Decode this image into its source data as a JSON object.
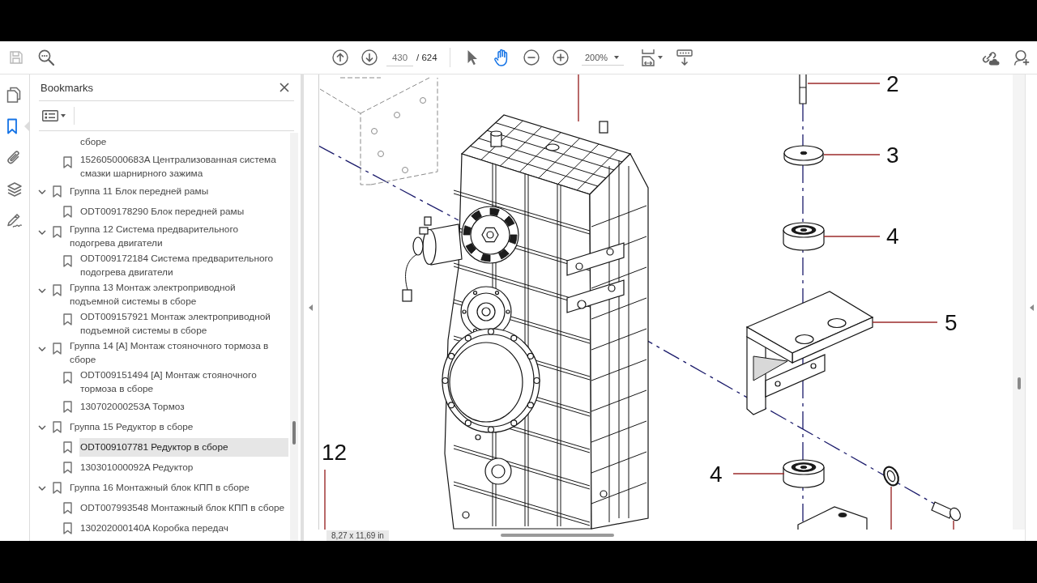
{
  "toolbar": {
    "save_button": {
      "disabled": true
    },
    "page_field": {
      "value": "430"
    },
    "page_count": "/ 624",
    "tools": [
      {
        "kind": "select",
        "selected": false
      },
      {
        "kind": "hand",
        "selected": true
      }
    ],
    "zoom_field": {
      "value": "200%"
    }
  },
  "sidebar": {
    "tabs": [
      {
        "kind": "pages",
        "selected": false
      },
      {
        "kind": "bookmarks",
        "selected": true
      },
      {
        "kind": "attachments",
        "selected": false
      },
      {
        "kind": "layers",
        "selected": false
      },
      {
        "kind": "signatures",
        "selected": false
      }
    ]
  },
  "bookmarks_panel": {
    "title": "Bookmarks",
    "items": [
      {
        "kind": "offscreen",
        "children": [
          {
            "kind": "fragment",
            "title": "сборе",
            "selected": false
          },
          {
            "kind": "bookmark",
            "title": "152605000683A Централизованная система смазки шарнирного зажима",
            "selected": false
          }
        ]
      },
      {
        "kind": "group",
        "title": "Группа 11 Блок передней рамы",
        "expanded": true,
        "selected": false,
        "children": [
          {
            "kind": "bookmark",
            "title": "ODT009178290 Блок передней рамы",
            "selected": false
          }
        ]
      },
      {
        "kind": "group",
        "title": "Группа 12 Система предварительного подогрева двигатели",
        "expanded": true,
        "selected": false,
        "children": [
          {
            "kind": "bookmark",
            "title": "ODT009172184 Система предварительного подогрева двигатели",
            "selected": false
          }
        ]
      },
      {
        "kind": "group",
        "title": "Группа 13 Монтаж электроприводной подъемной системы в сборе",
        "expanded": true,
        "selected": false,
        "children": [
          {
            "kind": "bookmark",
            "title": "ODT009157921 Монтаж электроприводной подъемной системы в сборе",
            "selected": false
          }
        ]
      },
      {
        "kind": "group",
        "title": "Группа 14 [А] Монтаж стояночного тормоза в сборе",
        "expanded": true,
        "selected": false,
        "children": [
          {
            "kind": "bookmark",
            "title": "ODT009151494 [А] Монтаж стояночного тормоза в сборе",
            "selected": false
          },
          {
            "kind": "bookmark",
            "title": "130702000253A Тормоз",
            "selected": false
          }
        ]
      },
      {
        "kind": "group",
        "title": "Группа 15 Редуктор в сборе",
        "expanded": true,
        "selected": false,
        "children": [
          {
            "kind": "bookmark",
            "title": "ODT009107781 Редуктор в сборе",
            "selected": true
          },
          {
            "kind": "bookmark",
            "title": "130301000092A Редуктор",
            "selected": false
          }
        ]
      },
      {
        "kind": "group",
        "title": "Группа 16 Монтажный блок КПП в сборе",
        "expanded": true,
        "selected": false,
        "children": [
          {
            "kind": "bookmark",
            "title": "ODT007993548 Монтажный блок КПП в сборе",
            "selected": false
          },
          {
            "kind": "bookmark",
            "title": "130202000140A Коробка передач",
            "selected": false
          }
        ]
      }
    ]
  },
  "document": {
    "callouts": [
      {
        "label": "2"
      },
      {
        "label": "3"
      },
      {
        "label": "4"
      },
      {
        "label": "5"
      },
      {
        "label": "4"
      },
      {
        "label": "12"
      }
    ],
    "page_size": "8,27 x 11,69 in"
  }
}
